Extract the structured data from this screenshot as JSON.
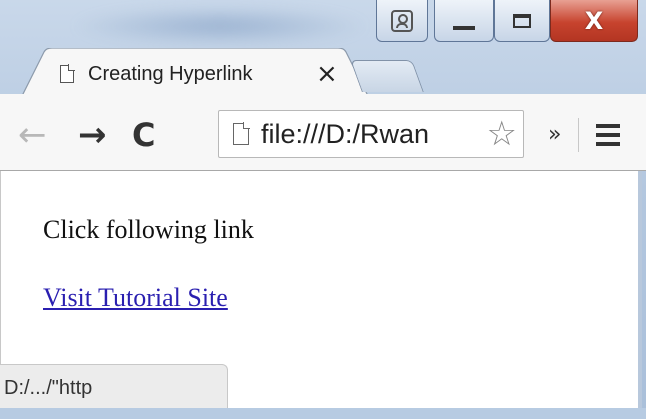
{
  "window": {
    "close_glyph": "X"
  },
  "tab": {
    "title": "Creating Hyperlink",
    "close_glyph": "×"
  },
  "toolbar": {
    "back_glyph": "←",
    "forward_glyph": "→",
    "reload_glyph": "C",
    "url": "file:///D:/Rwan",
    "bookmark_glyph": "☆",
    "overflow_glyph": "»"
  },
  "page": {
    "paragraph": "Click following link",
    "link_text": "Visit Tutorial Site"
  },
  "status_bar": {
    "text": "D:/.../\"http"
  },
  "colors": {
    "link": "#2a1fb0",
    "close_button": "#c7432e",
    "frame": "#b3c7df"
  }
}
